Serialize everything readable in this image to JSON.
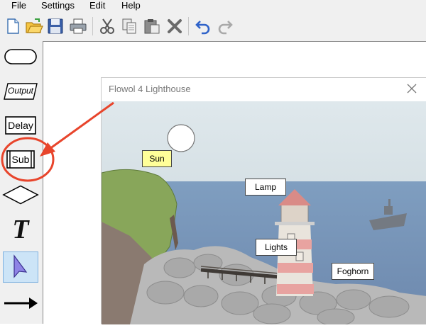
{
  "menu": {
    "file": "File",
    "settings": "Settings",
    "edit": "Edit",
    "help": "Help"
  },
  "toolbar": {
    "buttons": [
      "new-icon",
      "open-icon",
      "save-icon",
      "print-icon",
      "cut-icon",
      "copy-icon",
      "paste-icon",
      "delete-icon",
      "undo-icon",
      "redo-icon"
    ]
  },
  "palette": {
    "start_stop": "start-stop-shape",
    "output": "Output",
    "delay": "Delay",
    "sub": "Sub",
    "decision": "decision-shape",
    "text_tool": "T",
    "pointer": "pointer-icon",
    "connector": "arrow-icon"
  },
  "mimic": {
    "title": "Flowol 4 Lighthouse",
    "labels": {
      "sun": "Sun",
      "lamp": "Lamp",
      "lights": "Lights",
      "foghorn": "Foghorn"
    }
  },
  "colors": {
    "annotation": "#e8452c",
    "sun_label_bg": "#ffff99",
    "pointer_highlight": "#cce4f7"
  }
}
